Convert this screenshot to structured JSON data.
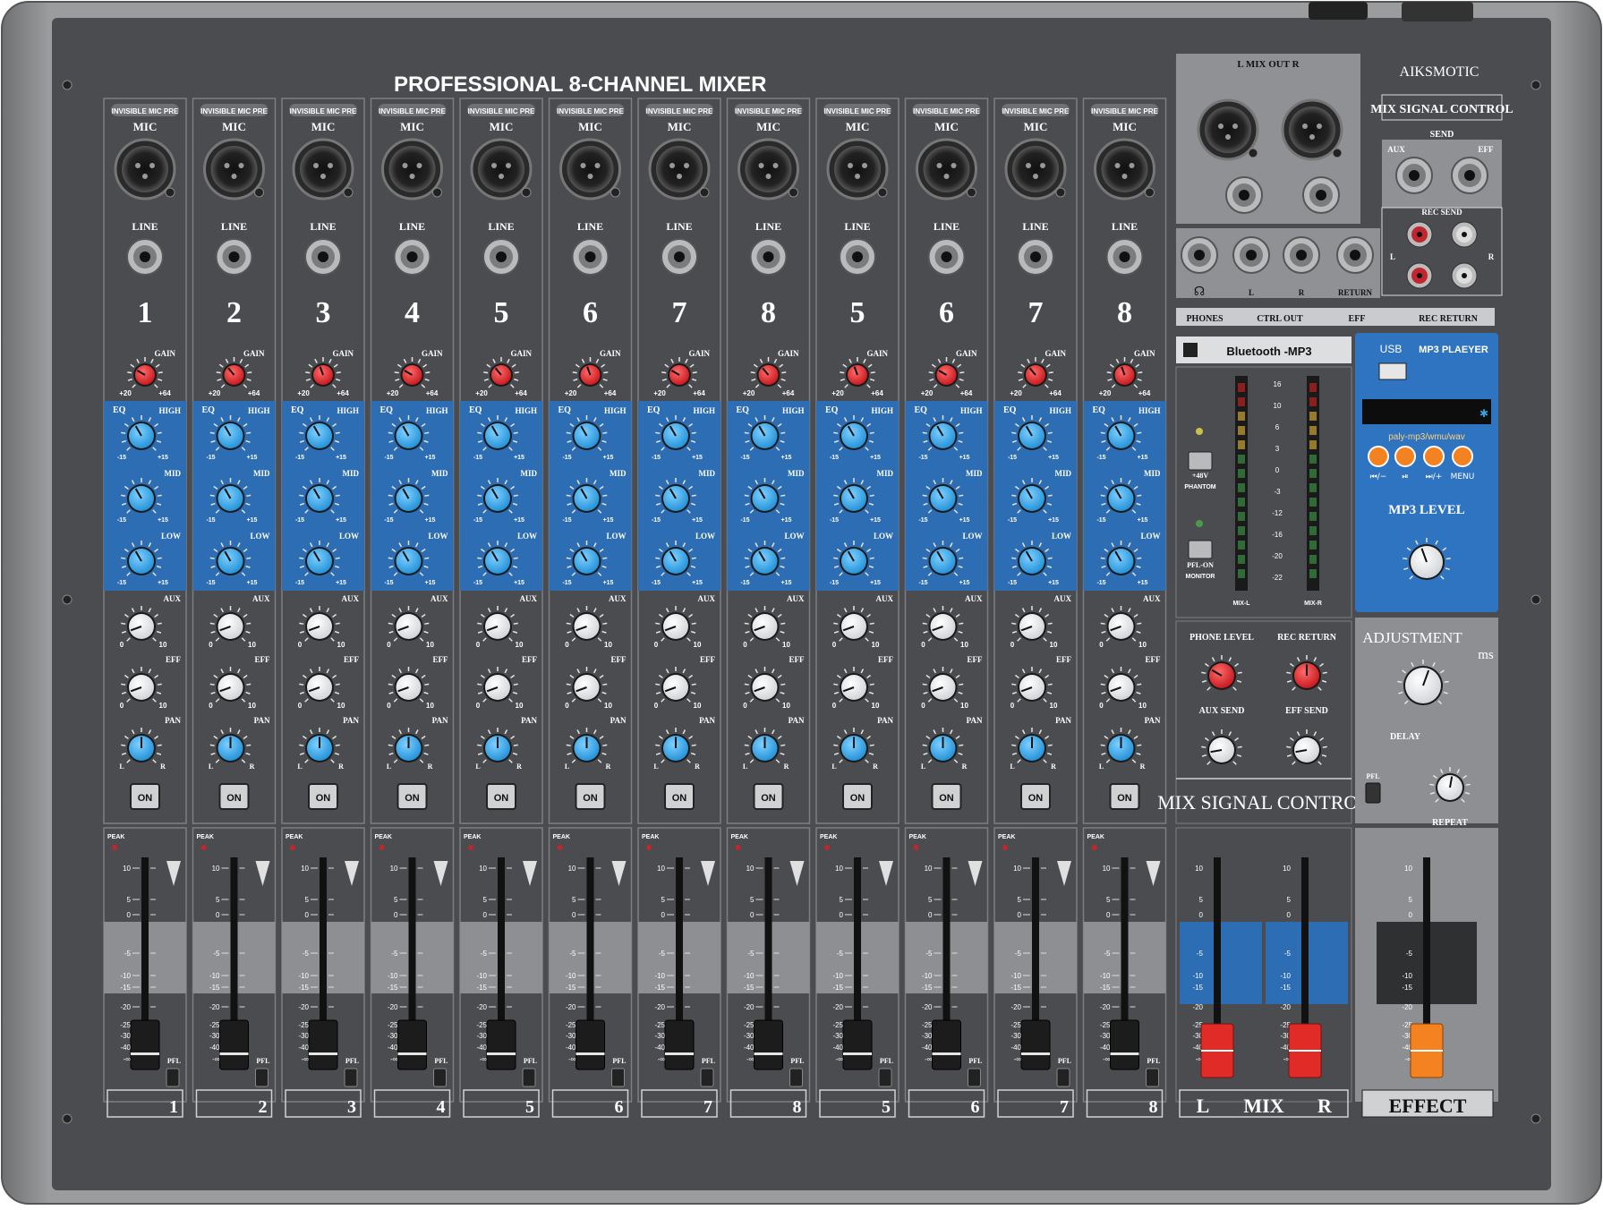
{
  "title": "PROFESSIONAL 8-CHANNEL MIXER",
  "brand": "AIKSMOTIC",
  "mix_signal_label": "MIX SIGNAL CONTROL",
  "send_label": "SEND",
  "aux_jack": "AUX",
  "eff_jack": "EFF",
  "rec_send": "REC SEND",
  "rec_l": "L",
  "rec_r": "R",
  "mix_out": "L   MIX OUT   R",
  "strip_labels": {
    "pre": "INVISIBLE MIC PRE",
    "mic": "MIC",
    "line": "LINE",
    "gain": "GAIN",
    "gain_min": "+20",
    "gain_max": "+64",
    "eq": "EQ",
    "high": "HIGH",
    "mid": "MID",
    "low": "LOW",
    "eq_min": "-15",
    "eq_max": "+15",
    "aux": "AUX",
    "eff": "EFF",
    "pan": "PAN",
    "pan_l": "L",
    "pan_r": "R",
    "zero": "0",
    "ten": "10",
    "on": "ON",
    "peak": "PEAK",
    "pfl": "PFL"
  },
  "channels": [
    {
      "number": "1",
      "footer": "1"
    },
    {
      "number": "2",
      "footer": "2"
    },
    {
      "number": "3",
      "footer": "3"
    },
    {
      "number": "4",
      "footer": "4"
    },
    {
      "number": "5",
      "footer": "5"
    },
    {
      "number": "6",
      "footer": "6"
    },
    {
      "number": "7",
      "footer": "7"
    },
    {
      "number": "8",
      "footer": "8"
    },
    {
      "number": "5",
      "footer": "5"
    },
    {
      "number": "6",
      "footer": "6"
    },
    {
      "number": "7",
      "footer": "7"
    },
    {
      "number": "8",
      "footer": "8"
    }
  ],
  "fader_scale": [
    "10",
    "5",
    "0",
    "-5",
    "-10",
    "-15",
    "-20",
    "-25",
    "-30",
    "-40",
    "-∞"
  ],
  "io_row": {
    "labels": [
      "L",
      "R",
      "RETURN"
    ],
    "bottom": [
      "PHONES",
      "CTRL OUT",
      "EFF",
      "REC RETURN"
    ]
  },
  "bt_label": "Bluetooth  -MP3",
  "phantom": {
    "line1": "+48V",
    "line2": "PHANTOM"
  },
  "pfl_on": {
    "line1": "PFL-ON",
    "line2": "MONITOR"
  },
  "meter_scale": [
    "16",
    "10",
    "6",
    "3",
    "0",
    "-3",
    "-12",
    "-16",
    "-20",
    "-22"
  ],
  "meter_l": "MIX-L",
  "meter_r": "MIX-R",
  "master_knobs": [
    "PHONE LEVEL",
    "REC RETURN",
    "AUX SEND",
    "EFF SEND"
  ],
  "usb": "USB",
  "mp3_player": "MP3 PLAEYER",
  "formats": "paly-mp3/wmu/wav",
  "mp3_buttons": [
    "⏮/−",
    "⏯",
    "⏭/+",
    "MENU"
  ],
  "mp3_level": "MP3 LEVEL",
  "adjustment": "ADJUSTMENT",
  "ms": "ms",
  "delay": "DELAY",
  "repeat": "REPEAT",
  "pfl": "PFL",
  "mix_footer": {
    "l": "L",
    "mix": "MIX",
    "r": "R"
  },
  "effect": "EFFECT",
  "colors": {
    "body": "#4b4d4f",
    "frame": "#8a8c8e",
    "eq_blue": "#2d6db4",
    "knob_blue": "#3aa3e0",
    "gain_red": "#d9262a",
    "fader_red": "#e02b27",
    "fader_orange": "#f58220",
    "mp3_panel": "#2f74c0"
  }
}
